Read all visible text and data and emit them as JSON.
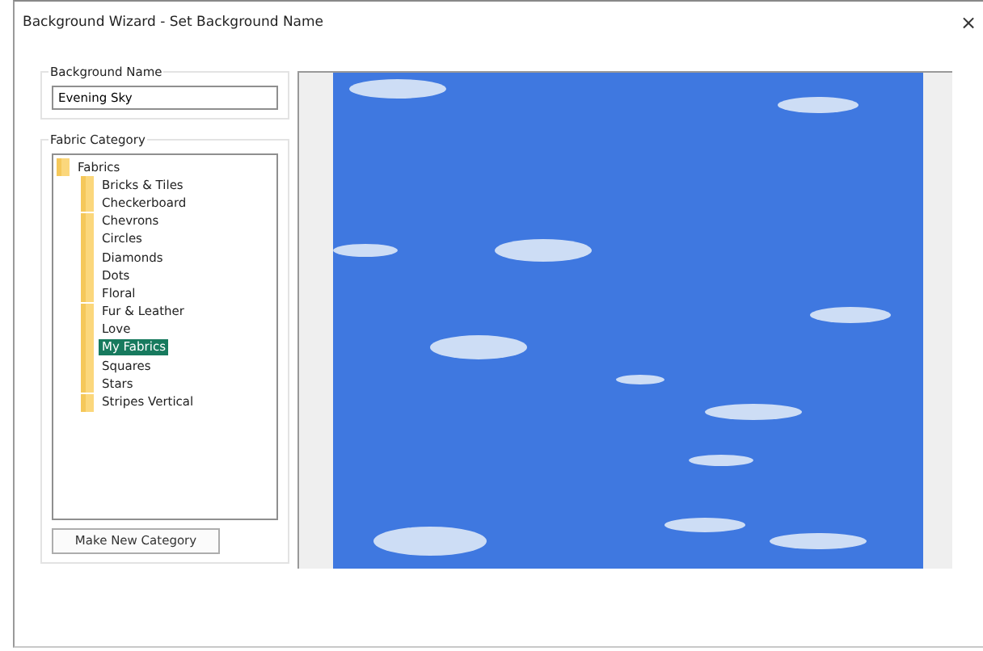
{
  "window": {
    "title": "Background Wizard - Set Background Name",
    "close": "×"
  },
  "background_name": {
    "label": "Background Name",
    "value": "Evening Sky"
  },
  "fabric_category": {
    "label": "Fabric Category",
    "tree": [
      {
        "label": "Fabrics",
        "selected": false,
        "children": [
          {
            "label": "Bricks & Tiles",
            "selected": false
          },
          {
            "label": "Checkerboard",
            "selected": false
          },
          {
            "label": "Chevrons",
            "selected": false
          },
          {
            "label": "Circles",
            "selected": false
          },
          {
            "label": "Diamonds",
            "selected": false
          },
          {
            "label": "Dots",
            "selected": false
          },
          {
            "label": "Floral",
            "selected": false
          },
          {
            "label": "Fur & Leather",
            "selected": false
          },
          {
            "label": "Love",
            "selected": false
          },
          {
            "label": "My Fabrics",
            "selected": true
          },
          {
            "label": "Squares",
            "selected": false
          },
          {
            "label": "Stars",
            "selected": false
          },
          {
            "label": "Stripes Vertical",
            "selected": false
          }
        ]
      }
    ],
    "button": "Make New Category"
  }
}
